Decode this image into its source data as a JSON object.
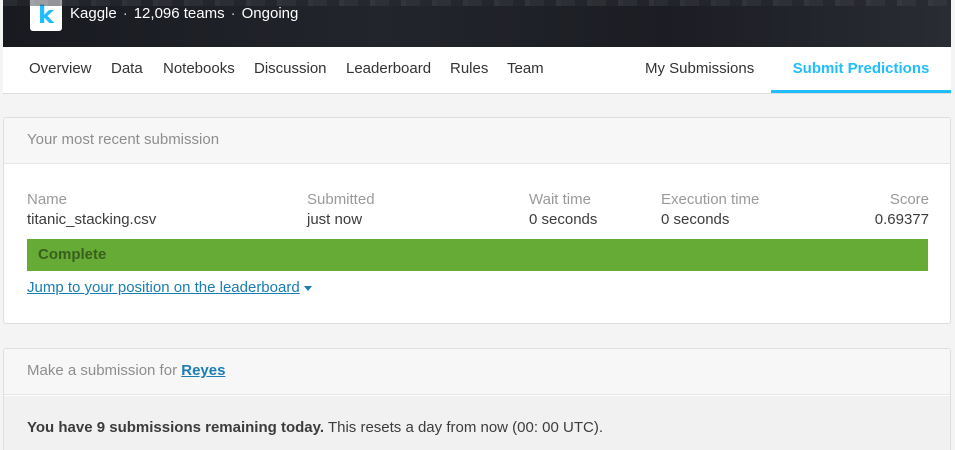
{
  "header": {
    "org": "Kaggle",
    "teams": "12,096 teams",
    "status": "Ongoing",
    "separator": "·"
  },
  "nav": {
    "tabs": [
      "Overview",
      "Data",
      "Notebooks",
      "Discussion",
      "Leaderboard",
      "Rules",
      "Team"
    ],
    "my_submissions": "My Submissions",
    "submit_predictions": "Submit Predictions"
  },
  "recent": {
    "title": "Your most recent submission",
    "columns": {
      "name": "Name",
      "submitted": "Submitted",
      "wait": "Wait time",
      "execution": "Execution time",
      "score": "Score"
    },
    "row": {
      "name": "titanic_stacking.csv",
      "submitted": "just now",
      "wait": "0 seconds",
      "execution": "0 seconds",
      "score": "0.69377"
    },
    "status": "Complete",
    "jump_link": "Jump to your position on the leaderboard"
  },
  "make_submission": {
    "title_prefix": "Make a submission for",
    "team_name": "Reyes",
    "remaining_bold": "You have 9 submissions remaining today.",
    "remaining_rest": "This resets a day from now (00: 00 UTC)."
  },
  "colors": {
    "accent": "#20beff",
    "complete": "#66ab35",
    "link": "#1a7db3"
  }
}
